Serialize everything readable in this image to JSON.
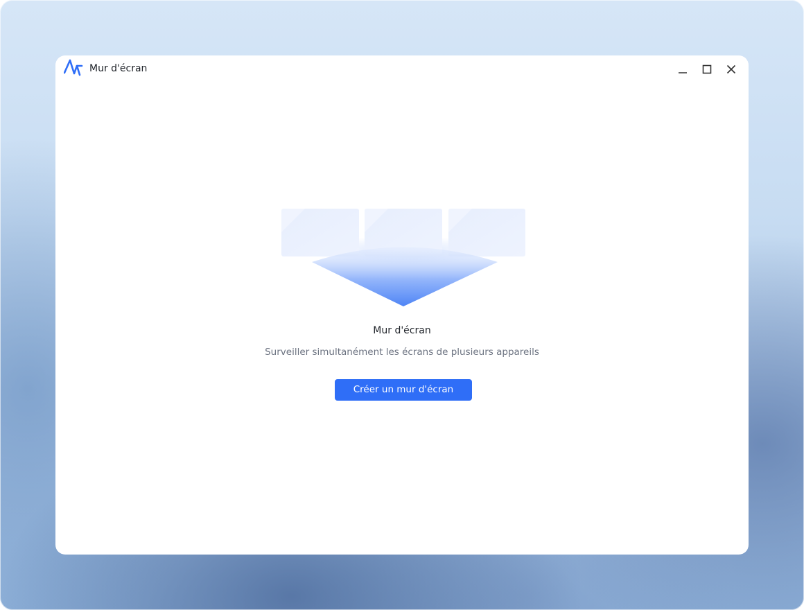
{
  "window": {
    "title": "Mur d'écran",
    "logo_icon": "app-logo-icon",
    "controls": {
      "minimize_icon": "minimize-icon",
      "maximize_icon": "maximize-icon",
      "close_icon": "close-icon"
    }
  },
  "empty_state": {
    "illustration_icon": "screen-wall-illustration",
    "title": "Mur d'écran",
    "description": "Surveiller simultanément les écrans de plusieurs appareils",
    "create_button_label": "Créer un mur d'écran"
  },
  "colors": {
    "accent": "#2f6ef7",
    "logo": "#2f6ef7",
    "title_text": "#1f2329",
    "secondary_text": "#6b7280"
  }
}
